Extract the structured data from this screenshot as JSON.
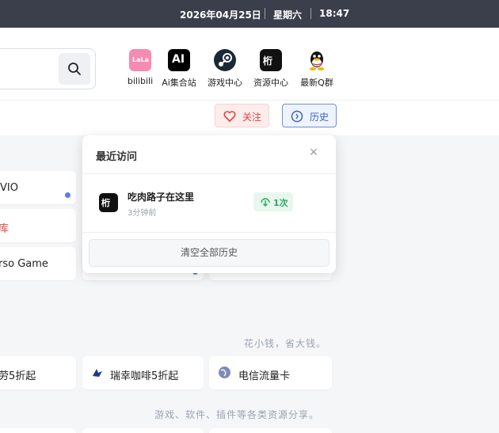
{
  "topbar": {
    "date": "2026年04月25日",
    "weekday": "星期六",
    "time": "18:47"
  },
  "header": {
    "apps": [
      {
        "label": "bilibili",
        "icon": "bilibili-icon"
      },
      {
        "label": "Ai集合站",
        "icon": "ai-icon"
      },
      {
        "label": "游戏中心",
        "icon": "steam-icon"
      },
      {
        "label": "资源中心",
        "icon": "resource-icon"
      },
      {
        "label": "最新Q群",
        "icon": "qq-icon"
      }
    ],
    "follow_label": "关注",
    "history_label": "历史"
  },
  "background": {
    "cards": [
      "VIO",
      "库",
      "rso Game",
      "劳5折起",
      "瑞幸咖啡5折起",
      "电信流量卡"
    ],
    "slogans": [
      "花小钱，省大钱。",
      "游戏、软件、插件等各类资源分享。"
    ]
  },
  "popup": {
    "title": "最近访问",
    "item": {
      "name": "吃肉路子在这里",
      "time": "3分钟前",
      "count": "1次"
    },
    "clear_label": "清空全部历史"
  },
  "colors": {
    "accent": "#3c63c8",
    "danger": "#e2443f",
    "success": "#2aa860",
    "topbar": "#3a3f4b"
  }
}
